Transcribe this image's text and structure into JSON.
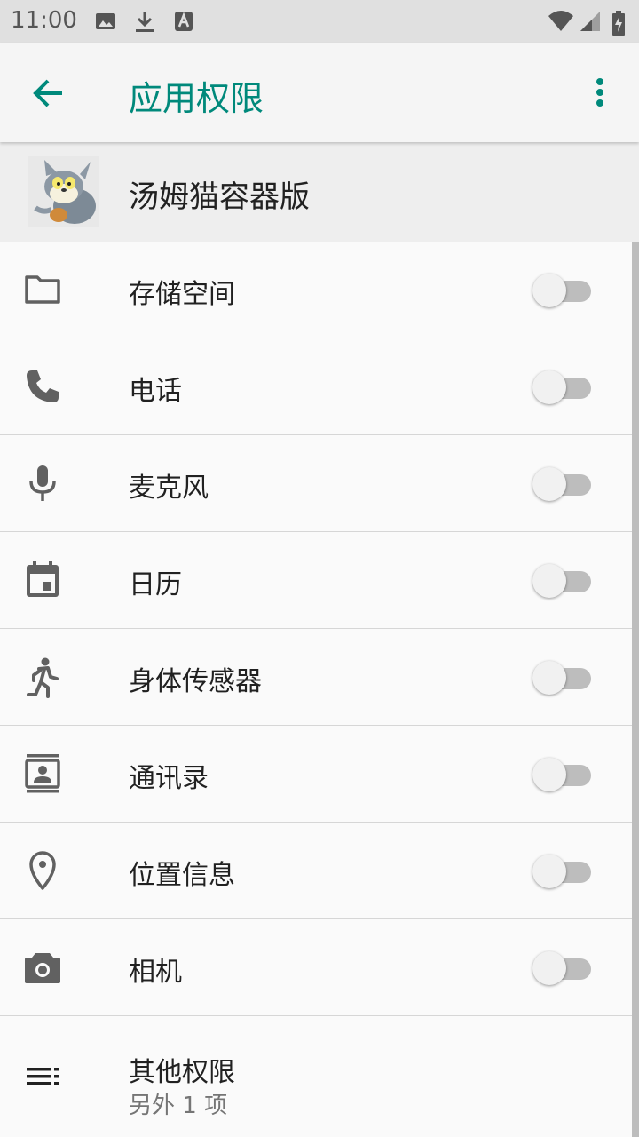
{
  "status_bar": {
    "time": "11:00"
  },
  "app_bar": {
    "title": "应用权限"
  },
  "app": {
    "name": "汤姆猫容器版"
  },
  "permissions": [
    {
      "label": "存储空间",
      "icon": "folder-icon",
      "enabled": false
    },
    {
      "label": "电话",
      "icon": "phone-icon",
      "enabled": false
    },
    {
      "label": "麦克风",
      "icon": "microphone-icon",
      "enabled": false
    },
    {
      "label": "日历",
      "icon": "calendar-icon",
      "enabled": false
    },
    {
      "label": "身体传感器",
      "icon": "body-sensor-icon",
      "enabled": false
    },
    {
      "label": "通讯录",
      "icon": "contacts-icon",
      "enabled": false
    },
    {
      "label": "位置信息",
      "icon": "location-icon",
      "enabled": false
    },
    {
      "label": "相机",
      "icon": "camera-icon",
      "enabled": false
    }
  ],
  "other": {
    "label": "其他权限",
    "sub": "另外 1 项",
    "icon": "list-icon"
  },
  "colors": {
    "accent": "#00897b",
    "icon_gray": "#616161",
    "toggle_off_track": "#bdbdbd"
  }
}
